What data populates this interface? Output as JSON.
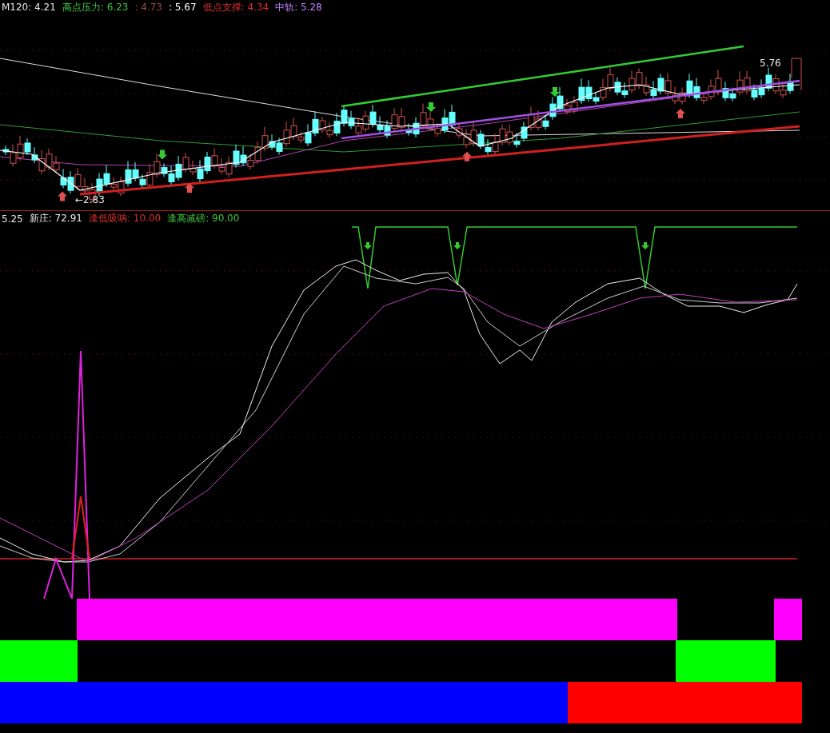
{
  "price_panel": {
    "legend": [
      {
        "text": "M120: 4.21",
        "color": "#e8e8e8"
      },
      {
        "text": "高点压力: 6.23",
        "color": "#3fc43f"
      },
      {
        "text": ": 4.73",
        "color": "#a04848"
      },
      {
        "text": ": 5.67",
        "color": "#ffffff"
      },
      {
        "text": "低点支撑: 4.34",
        "color": "#d83030"
      },
      {
        "text": "中轨: 5.28",
        "color": "#c080ff"
      }
    ],
    "high_label": "5.76",
    "low_label": "←2.83"
  },
  "indicator_panel": {
    "legend": [
      {
        "text": "5.25",
        "color": "#e8e8e8"
      },
      {
        "text": "新庄: 72.91",
        "color": "#e8e8e8"
      },
      {
        "text": "逢低吸呐: 10.00",
        "color": "#d83030"
      },
      {
        "text": "逢高减磅: 90.00",
        "color": "#3fc43f"
      }
    ]
  }
}
